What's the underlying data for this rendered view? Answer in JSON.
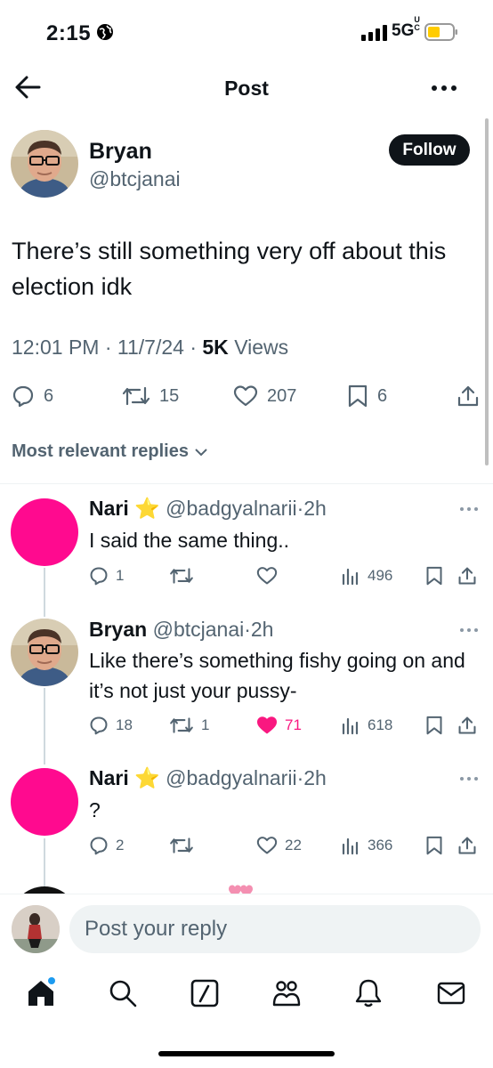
{
  "status_bar": {
    "time": "2:15",
    "network": "5G",
    "network_sub": "UC"
  },
  "header": {
    "title": "Post"
  },
  "post": {
    "author_name": "Bryan",
    "author_handle": "@btcjanai",
    "follow_label": "Follow",
    "text": "There’s still something very off about this election idk",
    "time": "12:01 PM",
    "date": "11/7/24",
    "views_count": "5K",
    "views_label": "Views",
    "replies": "6",
    "reposts": "15",
    "likes": "207",
    "bookmarks": "6"
  },
  "replies_sort": {
    "label": "Most relevant replies"
  },
  "replies": [
    {
      "name": "Nari",
      "emoji": "⭐",
      "handle": "@badgyalnarii",
      "time": "2h",
      "text": "I said the same thing..",
      "replies": "1",
      "reposts": "",
      "likes": "",
      "views": "496"
    },
    {
      "name": "Bryan",
      "emoji": "",
      "handle": "@btcjanai",
      "time": "2h",
      "text": "Like there’s something fishy going on and it’s not just your pussy-",
      "replies": "18",
      "reposts": "1",
      "likes": "71",
      "views": "618"
    },
    {
      "name": "Nari",
      "emoji": "⭐",
      "handle": "@badgyalnarii",
      "time": "2h",
      "text": "?",
      "replies": "2",
      "reposts": "",
      "likes": "22",
      "views": "366"
    }
  ],
  "composer": {
    "placeholder": "Post your reply"
  },
  "colors": {
    "accent": "#1d9bf0",
    "like_active": "#f91880",
    "pink_avatar": "#ff0a8f",
    "text_primary": "#0f1419",
    "text_secondary": "#536471"
  },
  "icons": [
    "back-arrow-icon",
    "more-icon",
    "reply-icon",
    "repost-icon",
    "like-icon",
    "bookmark-icon",
    "share-icon",
    "views-icon",
    "home-icon",
    "search-icon",
    "grok-icon",
    "communities-icon",
    "notifications-icon",
    "messages-icon"
  ]
}
